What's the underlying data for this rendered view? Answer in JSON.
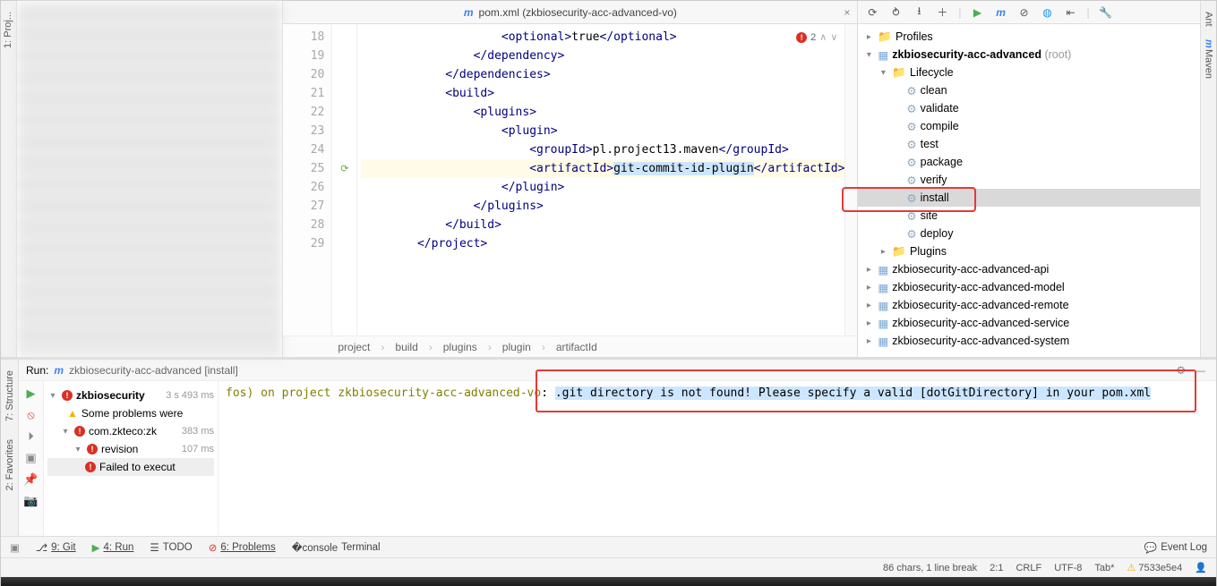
{
  "editor": {
    "tab_icon": "m",
    "tab_title": "pom.xml (zkbiosecurity-acc-advanced-vo)",
    "error_count": "2",
    "lines": [
      {
        "n": "18",
        "html": "                    <span class='t-tag'>&lt;optional&gt;</span>true<span class='t-tag'>&lt;/optional&gt;</span>"
      },
      {
        "n": "19",
        "html": "                <span class='t-tag'>&lt;/dependency&gt;</span>"
      },
      {
        "n": "20",
        "html": "            <span class='t-tag'>&lt;/dependencies&gt;</span>"
      },
      {
        "n": "21",
        "html": "            <span class='t-tag'>&lt;build&gt;</span>"
      },
      {
        "n": "22",
        "html": "                <span class='t-tag'>&lt;plugins&gt;</span>"
      },
      {
        "n": "23",
        "html": "                    <span class='t-tag'>&lt;plugin&gt;</span>"
      },
      {
        "n": "24",
        "html": "                        <span class='t-tag'>&lt;groupId&gt;</span>pl.project13.maven<span class='t-tag'>&lt;/groupId&gt;</span>"
      },
      {
        "n": "25",
        "hl": true,
        "html": "                        <span class='t-tag'>&lt;artifactId&gt;</span><span class='t-sel'>git-commit-id-plugin</span><span class='t-tag'>&lt;/artifactId&gt;</span>"
      },
      {
        "n": "26",
        "html": "                    <span class='t-tag'>&lt;/plugin&gt;</span>"
      },
      {
        "n": "27",
        "html": "                <span class='t-tag'>&lt;/plugins&gt;</span>"
      },
      {
        "n": "28",
        "html": "            <span class='t-tag'>&lt;/build&gt;</span>"
      },
      {
        "n": "29",
        "html": "        <span class='t-tag'>&lt;/project&gt;</span>"
      }
    ],
    "breadcrumb": [
      "project",
      "build",
      "plugins",
      "plugin",
      "artifactId"
    ]
  },
  "left_tabs": {
    "project": "1: Proj..."
  },
  "right_tabs": {
    "ant": "Ant",
    "maven": "Maven"
  },
  "maven": {
    "profiles": "Profiles",
    "root_module": "zkbiosecurity-acc-advanced",
    "root_suffix": "(root)",
    "lifecycle_label": "Lifecycle",
    "lifecycle": [
      "clean",
      "validate",
      "compile",
      "test",
      "package",
      "verify",
      "install",
      "site",
      "deploy"
    ],
    "plugins_label": "Plugins",
    "modules": [
      "zkbiosecurity-acc-advanced-api",
      "zkbiosecurity-acc-advanced-model",
      "zkbiosecurity-acc-advanced-remote",
      "zkbiosecurity-acc-advanced-service",
      "zkbiosecurity-acc-advanced-system"
    ]
  },
  "run": {
    "header_prefix": "Run:",
    "header_tab": "zkbiosecurity-acc-advanced [install]",
    "tree": {
      "root": "zkbiosecurity",
      "root_time": "3 s 493 ms",
      "warn": "Some problems were",
      "goal": "com.zkteco:zk",
      "goal_time": "383 ms",
      "revision": "revision",
      "revision_time": "107 ms",
      "fail": "Failed to execut"
    },
    "console_prefix": "fos) on project zkbiosecurity-acc-advanced-vo",
    "console_colon": ": ",
    "console_msg": ".git directory is not found! Please specify a valid [dotGitDirectory] in your pom.xml"
  },
  "left_run_tabs": {
    "structure": "7: Structure",
    "favorites": "2: Favorites"
  },
  "bottom": {
    "git": "9: Git",
    "run": "4: Run",
    "todo": "TODO",
    "problems": "6: Problems",
    "terminal": "Terminal",
    "event_log": "Event Log"
  },
  "status": {
    "chars": "86 chars, 1 line break",
    "pos": "2:1",
    "eol": "CRLF",
    "enc": "UTF-8",
    "tab": "Tab*",
    "branch": "7533e5e4"
  }
}
